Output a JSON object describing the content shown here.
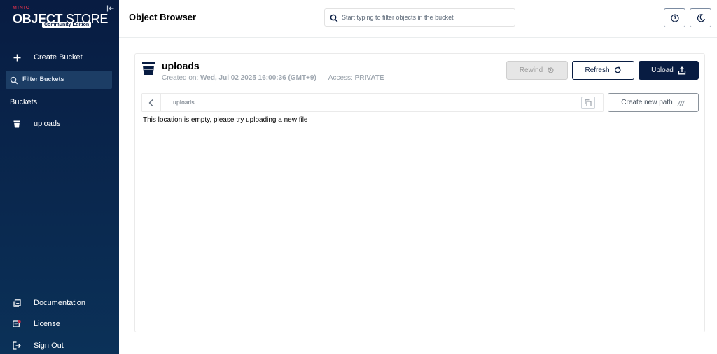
{
  "brand": {
    "vendor": "MINIO",
    "product_bold": "OBJECT",
    "product_thin": "STORE",
    "edition": "Community Edition"
  },
  "sidebar": {
    "create_bucket": "Create Bucket",
    "filter_buckets": "Filter Buckets",
    "buckets_title": "Buckets",
    "buckets": [
      {
        "label": "uploads"
      }
    ],
    "footer": [
      {
        "label": "Documentation"
      },
      {
        "label": "License"
      },
      {
        "label": "Sign Out"
      }
    ]
  },
  "header": {
    "title": "Object Browser",
    "search_placeholder": "Start typing to filter objects in the bucket"
  },
  "bucket": {
    "name": "uploads",
    "created_label": "Created on:",
    "created_value": "Wed, Jul 02 2025 16:00:36 (GMT+9)",
    "access_label": "Access:",
    "access_value": "PRIVATE"
  },
  "actions": {
    "rewind": "Rewind",
    "refresh": "Refresh",
    "upload": "Upload",
    "create_path": "Create new path"
  },
  "path": {
    "current": "uploads"
  },
  "empty_message": "This location is empty, please try uploading a new file",
  "colors": {
    "sidebar_bg": "#081c42",
    "primary": "#081c42",
    "brand_red": "#c72e49"
  }
}
